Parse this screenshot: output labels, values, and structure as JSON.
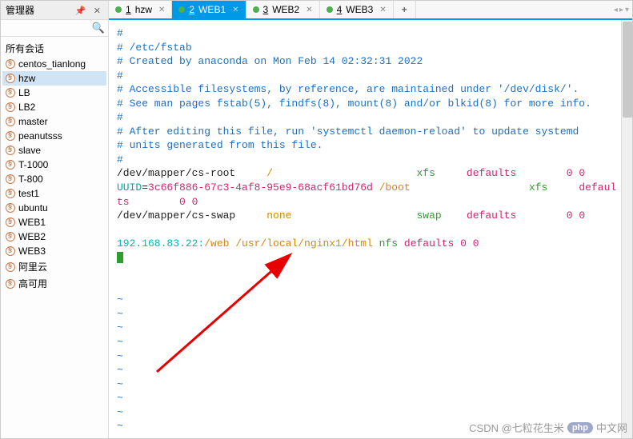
{
  "sidebar": {
    "title": "管理器",
    "root": "所有会话",
    "items": [
      {
        "label": "centos_tianlong"
      },
      {
        "label": "hzw"
      },
      {
        "label": "LB"
      },
      {
        "label": "LB2"
      },
      {
        "label": "master"
      },
      {
        "label": "peanutsss"
      },
      {
        "label": "slave"
      },
      {
        "label": "T-1000"
      },
      {
        "label": "T-800"
      },
      {
        "label": "test1"
      },
      {
        "label": "ubuntu"
      },
      {
        "label": "WEB1"
      },
      {
        "label": "WEB2"
      },
      {
        "label": "WEB3"
      },
      {
        "label": "阿里云"
      },
      {
        "label": "高可用"
      }
    ],
    "selected_index": 1
  },
  "tabs": {
    "items": [
      {
        "num": "1",
        "label": "hzw"
      },
      {
        "num": "2",
        "label": "WEB1"
      },
      {
        "num": "3",
        "label": "WEB2"
      },
      {
        "num": "4",
        "label": "WEB3"
      }
    ],
    "active_index": 1,
    "add": "+"
  },
  "terminal": {
    "l1": "#",
    "l2": "# /etc/fstab",
    "l3": "# Created by anaconda on Mon Feb 14 02:32:31 2022",
    "l4": "#",
    "l5": "# Accessible filesystems, by reference, are maintained under '/dev/disk/'.",
    "l6": "# See man pages fstab(5), findfs(8), mount(8) and/or blkid(8) for more info.",
    "l7": "#",
    "l8": "# After editing this file, run 'systemctl daemon-reload' to update systemd",
    "l9": "# units generated from this file.",
    "l10": "#",
    "root_dev": "/dev/mapper/cs-root",
    "root_mnt": "/",
    "root_fs": "xfs",
    "root_def": "defaults",
    "root_n1": "0",
    "root_n2": "0",
    "uuid_key": "UUID",
    "uuid_eq": "=",
    "uuid_val": "3c66f886-67c3-4af8-95e9-68acf61bd76d",
    "boot_mnt": " /boot",
    "boot_fs": "xfs",
    "boot_def": "defaul",
    "boot_wrap": "ts",
    "boot_n1": "0",
    "boot_n2": "0",
    "swap_dev": "/dev/mapper/cs-swap",
    "swap_none": "none",
    "swap_fs": "swap",
    "swap_def": "defaults",
    "swap_n1": "0",
    "swap_n2": "0",
    "nfs_ip": "192.168.83.22:",
    "nfs_path": "/web /usr/local/nginx1/html",
    "nfs_fs": "nfs",
    "nfs_def": "defaults",
    "nfs_n1": "0",
    "nfs_n2": "0",
    "tilde": "~"
  },
  "watermark": {
    "csdn": "CSDN @七粒花生米",
    "php": "php",
    "cn": "中文网"
  }
}
